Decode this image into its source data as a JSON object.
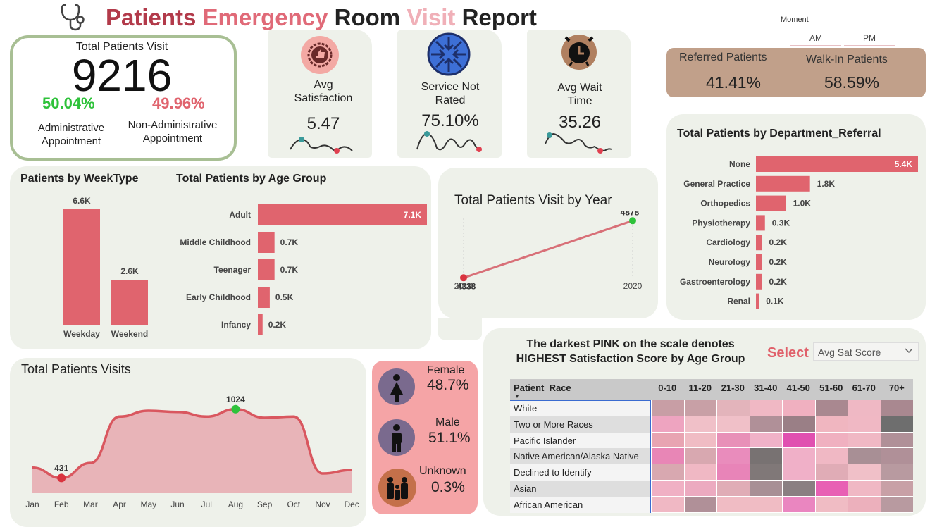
{
  "header": {
    "w1": "Patients",
    "w2": "Emergency",
    "w3": "Room",
    "w4": "Visit",
    "w5": "Report",
    "icon": "stethoscope-icon"
  },
  "moment": {
    "label": "Moment",
    "am": "AM",
    "pm": "PM"
  },
  "referral": {
    "referred_label": "Referred Patients",
    "referred_value": "41.41%",
    "walkin_label": "Walk-In Patients",
    "walkin_value": "58.59%"
  },
  "total_visit": {
    "title": "Total Patients Visit",
    "value": "9216",
    "admin_pct": "50.04%",
    "admin_label1": "Administrative",
    "admin_label2": "Appointment",
    "nonadmin_pct": "49.96%",
    "nonadmin_label1": "Non-Administrative",
    "nonadmin_label2": "Appointment"
  },
  "kpis": [
    {
      "label1": "Avg",
      "label2": "Satisfaction",
      "value": "5.47",
      "icon": "thumbs-up-badge-icon"
    },
    {
      "label1": "Service Not",
      "label2": "Rated",
      "value": "75.10%",
      "icon": "compress-arrows-icon"
    },
    {
      "label1": "Avg Wait",
      "label2": "Time",
      "value": "35.26",
      "icon": "alarm-clock-icon"
    }
  ],
  "gender": [
    {
      "label": "Female",
      "value": "48.7%",
      "icon": "female-icon"
    },
    {
      "label": "Male",
      "value": "51.1%",
      "icon": "male-icon"
    },
    {
      "label": "Unknown",
      "value": "0.3%",
      "icon": "family-icon"
    }
  ],
  "heatmap": {
    "note1": "The darkest PINK on the scale denotes",
    "note2": "HIGHEST Satisfaction Score by Age Group",
    "select_label": "Select",
    "select_value": "Avg Sat Score",
    "header": "Patient_Race",
    "columns": [
      "0-10",
      "11-20",
      "21-30",
      "31-40",
      "41-50",
      "51-60",
      "61-70",
      "70+"
    ],
    "rows": [
      "White",
      "Two or More Races",
      "Pacific Islander",
      "Native American/Alaska Native",
      "Declined to Identify",
      "Asian",
      "African American"
    ],
    "colors": [
      [
        "#c89ea5",
        "#c8a0a6",
        "#e3b4bb",
        "#f0b8c4",
        "#f0b0c0",
        "#a98890",
        "#efb8c4",
        "#a98890"
      ],
      [
        "#eea4c0",
        "#f0c0c8",
        "#f0c0c8",
        "#b09098",
        "#9a7f86",
        "#f0b6c0",
        "#f0b8c4",
        "#6e6e6e"
      ],
      [
        "#e8a4b2",
        "#f0bcc4",
        "#e890b8",
        "#f0b2c8",
        "#e050b0",
        "#f0b0c0",
        "#f0b8c4",
        "#b09098"
      ],
      [
        "#e886b6",
        "#d8a8b0",
        "#e98cbc",
        "#787272",
        "#f0b0c8",
        "#f0b8c4",
        "#a88f95",
        "#b09098"
      ],
      [
        "#d8a8b0",
        "#f0b8c4",
        "#e884b8",
        "#807878",
        "#f0b0c8",
        "#e0acb6",
        "#f0c0c8",
        "#b89aa0"
      ],
      [
        "#f0b0c4",
        "#ecaac0",
        "#e0acb6",
        "#a88f95",
        "#8a7f82",
        "#e860b4",
        "#f0b8c4",
        "#c8a0a6"
      ],
      [
        "#f0b8c4",
        "#b09098",
        "#f0bcc4",
        "#f0bcc4",
        "#ea86c0",
        "#f0bcc4",
        "#ecb0bc",
        "#b89aa0"
      ]
    ]
  },
  "chart_data": [
    {
      "type": "bar",
      "title": "Patients by WeekType",
      "categories": [
        "Weekday",
        "Weekend"
      ],
      "values": [
        6.6,
        2.6
      ],
      "labels": [
        "6.6K",
        "2.6K"
      ],
      "color": "#e0646e"
    },
    {
      "type": "bar",
      "orientation": "horizontal",
      "title": "Total Patients by Age Group",
      "categories": [
        "Adult",
        "Middle Childhood",
        "Teenager",
        "Early Childhood",
        "Infancy"
      ],
      "values": [
        7.1,
        0.7,
        0.7,
        0.5,
        0.2
      ],
      "labels": [
        "7.1K",
        "0.7K",
        "0.7K",
        "0.5K",
        "0.2K"
      ],
      "color": "#e0646e"
    },
    {
      "type": "line",
      "title": "Total Patients Visit by Year",
      "x": [
        "2019",
        "2020"
      ],
      "values": [
        4338,
        4878
      ],
      "labels": [
        "4338",
        "4878"
      ],
      "ylim": [
        4300,
        4900
      ]
    },
    {
      "type": "bar",
      "orientation": "horizontal",
      "title": "Total Patients by Department_Referral",
      "categories": [
        "None",
        "General Practice",
        "Orthopedics",
        "Physiotherapy",
        "Cardiology",
        "Neurology",
        "Gastroenterology",
        "Renal"
      ],
      "values": [
        5.4,
        1.8,
        1.0,
        0.3,
        0.2,
        0.2,
        0.2,
        0.1
      ],
      "labels": [
        "5.4K",
        "1.8K",
        "1.0K",
        "0.3K",
        "0.2K",
        "0.2K",
        "0.2K",
        "0.1K"
      ],
      "color": "#e0646e"
    },
    {
      "type": "area",
      "title": "Total Patients Visits",
      "x": [
        "Jan",
        "Feb",
        "Mar",
        "Apr",
        "May",
        "Jun",
        "Jul",
        "Aug",
        "Sep",
        "Oct",
        "Nov",
        "Dec"
      ],
      "values": [
        520,
        431,
        560,
        960,
        1010,
        1000,
        960,
        1024,
        950,
        960,
        470,
        500
      ],
      "labels": {
        "min": "431",
        "max": "1024"
      },
      "ylim": [
        300,
        1150
      ]
    }
  ]
}
